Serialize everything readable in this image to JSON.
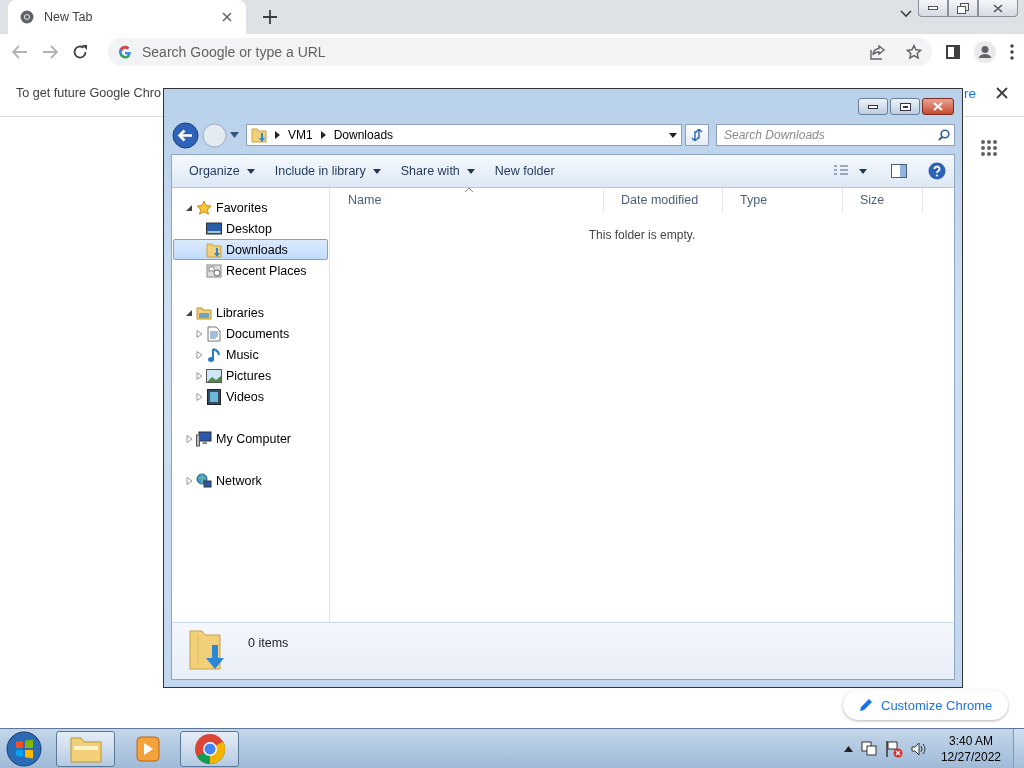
{
  "browser": {
    "tab": {
      "title": "New Tab",
      "selected": true
    },
    "omnibox": {
      "placeholder": "Search Google or type a URL"
    },
    "infobar": {
      "message": "To get future Google Chro",
      "link": "re"
    },
    "customize_button": "Customize Chrome"
  },
  "explorer": {
    "breadcrumb": [
      "VM1",
      "Downloads"
    ],
    "search": {
      "placeholder": "Search Downloads"
    },
    "toolbar": [
      {
        "label": "Organize",
        "dropdown": true
      },
      {
        "label": "Include in library",
        "dropdown": true
      },
      {
        "label": "Share with",
        "dropdown": true
      },
      {
        "label": "New folder",
        "dropdown": false
      }
    ],
    "nav": [
      {
        "label": "Favorites",
        "kind": "favorites",
        "expanded": true,
        "selected": false,
        "children": [
          {
            "label": "Desktop",
            "kind": "desktop",
            "selected": false
          },
          {
            "label": "Downloads",
            "kind": "downloads",
            "selected": true
          },
          {
            "label": "Recent Places",
            "kind": "recent",
            "selected": false
          }
        ]
      },
      {
        "label": "Libraries",
        "kind": "libraries",
        "expanded": true,
        "selected": false,
        "children": [
          {
            "label": "Documents",
            "kind": "documents",
            "expanded": false,
            "selected": false
          },
          {
            "label": "Music",
            "kind": "music",
            "expanded": false,
            "selected": false
          },
          {
            "label": "Pictures",
            "kind": "pictures",
            "expanded": false,
            "selected": false
          },
          {
            "label": "Videos",
            "kind": "videos",
            "expanded": false,
            "selected": false
          }
        ]
      },
      {
        "label": "My Computer",
        "kind": "computer",
        "expanded": false,
        "selected": false
      },
      {
        "label": "Network",
        "kind": "network",
        "expanded": false,
        "selected": false
      }
    ],
    "columns": [
      {
        "label": "Name",
        "sorted": true
      },
      {
        "label": "Date modified",
        "sorted": false
      },
      {
        "label": "Type",
        "sorted": false
      },
      {
        "label": "Size",
        "sorted": false
      }
    ],
    "empty_message": "This folder is empty.",
    "status": "0 items"
  },
  "taskbar": {
    "buttons": [
      {
        "kind": "explorer"
      },
      {
        "kind": "media"
      },
      {
        "kind": "chrome"
      }
    ],
    "clock": {
      "time": "3:40 AM",
      "date": "12/27/2022"
    }
  }
}
